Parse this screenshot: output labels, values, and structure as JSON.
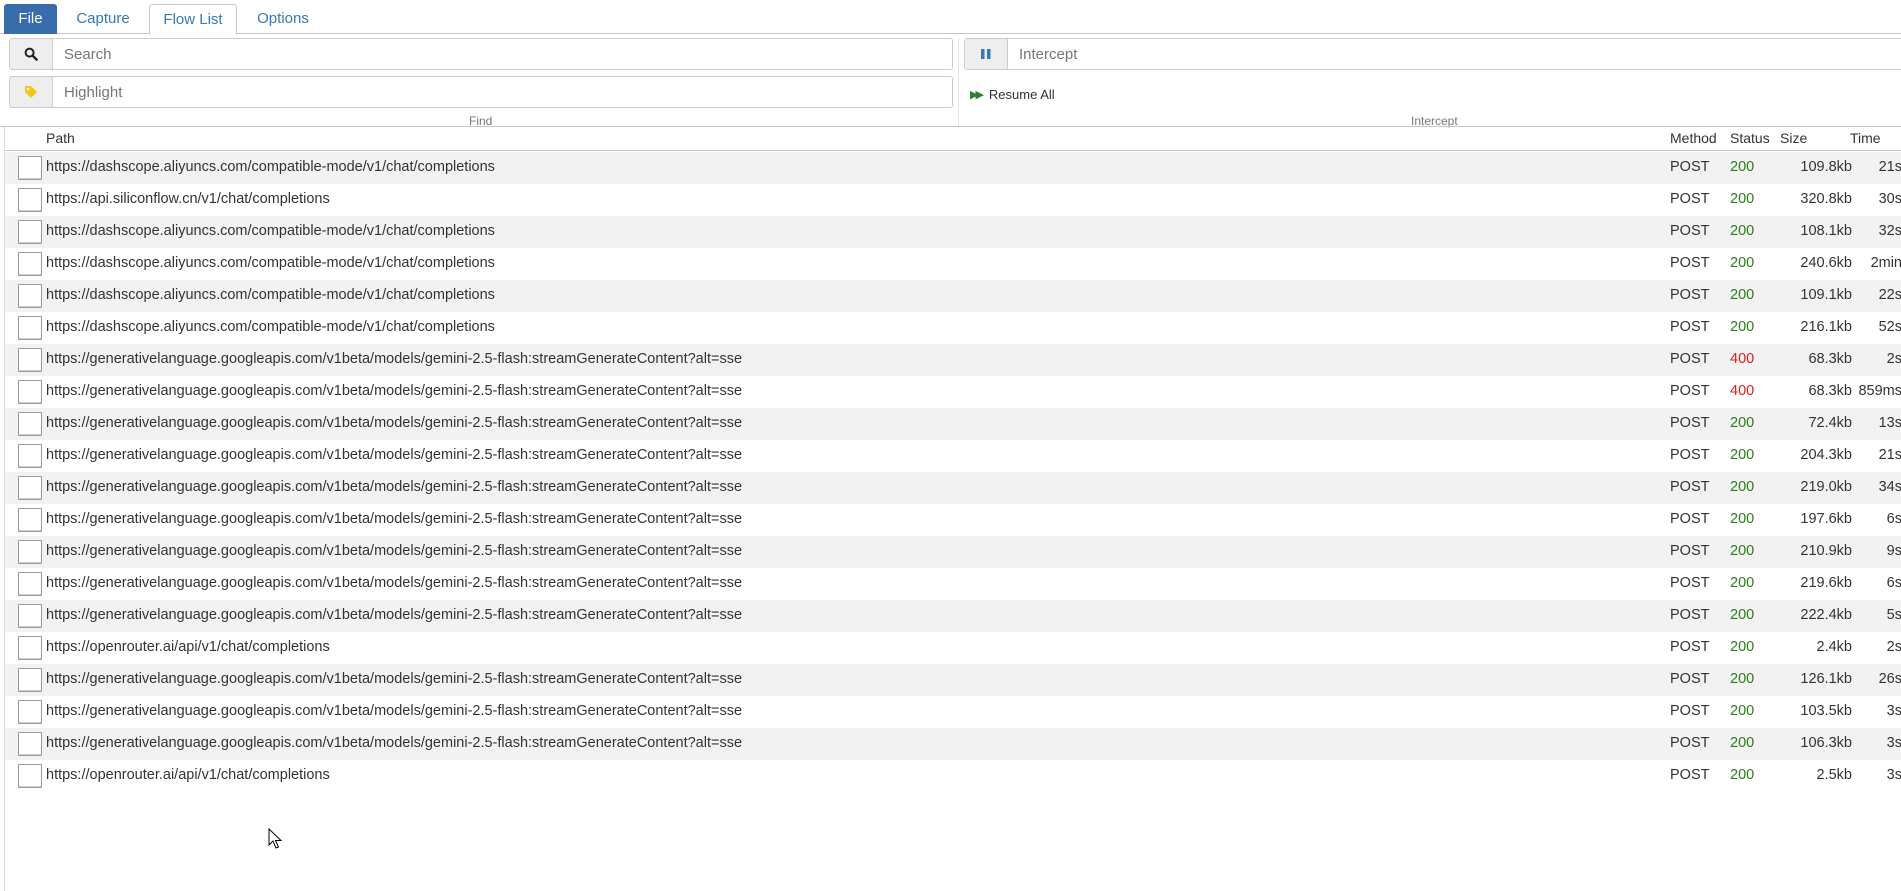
{
  "menu": {
    "tabs": [
      {
        "label": "File"
      },
      {
        "label": "Capture"
      },
      {
        "label": "Flow List"
      },
      {
        "label": "Options"
      }
    ]
  },
  "toolbar": {
    "search_placeholder": "Search",
    "highlight_placeholder": "Highlight",
    "intercept_placeholder": "Intercept",
    "resume_all_label": "Resume All",
    "find_group_label": "Find",
    "intercept_group_label": "Intercept"
  },
  "table": {
    "columns": {
      "path": "Path",
      "method": "Method",
      "status": "Status",
      "size": "Size",
      "time": "Time"
    },
    "rows": [
      {
        "path": "https://dashscope.aliyuncs.com/compatible-mode/v1/chat/completions",
        "method": "POST",
        "status": "200",
        "size": "109.8kb",
        "time": "21s"
      },
      {
        "path": "https://api.siliconflow.cn/v1/chat/completions",
        "method": "POST",
        "status": "200",
        "size": "320.8kb",
        "time": "30s"
      },
      {
        "path": "https://dashscope.aliyuncs.com/compatible-mode/v1/chat/completions",
        "method": "POST",
        "status": "200",
        "size": "108.1kb",
        "time": "32s"
      },
      {
        "path": "https://dashscope.aliyuncs.com/compatible-mode/v1/chat/completions",
        "method": "POST",
        "status": "200",
        "size": "240.6kb",
        "time": "2min"
      },
      {
        "path": "https://dashscope.aliyuncs.com/compatible-mode/v1/chat/completions",
        "method": "POST",
        "status": "200",
        "size": "109.1kb",
        "time": "22s"
      },
      {
        "path": "https://dashscope.aliyuncs.com/compatible-mode/v1/chat/completions",
        "method": "POST",
        "status": "200",
        "size": "216.1kb",
        "time": "52s"
      },
      {
        "path": "https://generativelanguage.googleapis.com/v1beta/models/gemini-2.5-flash:streamGenerateContent?alt=sse",
        "method": "POST",
        "status": "400",
        "size": "68.3kb",
        "time": "2s"
      },
      {
        "path": "https://generativelanguage.googleapis.com/v1beta/models/gemini-2.5-flash:streamGenerateContent?alt=sse",
        "method": "POST",
        "status": "400",
        "size": "68.3kb",
        "time": "859ms"
      },
      {
        "path": "https://generativelanguage.googleapis.com/v1beta/models/gemini-2.5-flash:streamGenerateContent?alt=sse",
        "method": "POST",
        "status": "200",
        "size": "72.4kb",
        "time": "13s"
      },
      {
        "path": "https://generativelanguage.googleapis.com/v1beta/models/gemini-2.5-flash:streamGenerateContent?alt=sse",
        "method": "POST",
        "status": "200",
        "size": "204.3kb",
        "time": "21s"
      },
      {
        "path": "https://generativelanguage.googleapis.com/v1beta/models/gemini-2.5-flash:streamGenerateContent?alt=sse",
        "method": "POST",
        "status": "200",
        "size": "219.0kb",
        "time": "34s"
      },
      {
        "path": "https://generativelanguage.googleapis.com/v1beta/models/gemini-2.5-flash:streamGenerateContent?alt=sse",
        "method": "POST",
        "status": "200",
        "size": "197.6kb",
        "time": "6s"
      },
      {
        "path": "https://generativelanguage.googleapis.com/v1beta/models/gemini-2.5-flash:streamGenerateContent?alt=sse",
        "method": "POST",
        "status": "200",
        "size": "210.9kb",
        "time": "9s"
      },
      {
        "path": "https://generativelanguage.googleapis.com/v1beta/models/gemini-2.5-flash:streamGenerateContent?alt=sse",
        "method": "POST",
        "status": "200",
        "size": "219.6kb",
        "time": "6s"
      },
      {
        "path": "https://generativelanguage.googleapis.com/v1beta/models/gemini-2.5-flash:streamGenerateContent?alt=sse",
        "method": "POST",
        "status": "200",
        "size": "222.4kb",
        "time": "5s"
      },
      {
        "path": "https://openrouter.ai/api/v1/chat/completions",
        "method": "POST",
        "status": "200",
        "size": "2.4kb",
        "time": "2s"
      },
      {
        "path": "https://generativelanguage.googleapis.com/v1beta/models/gemini-2.5-flash:streamGenerateContent?alt=sse",
        "method": "POST",
        "status": "200",
        "size": "126.1kb",
        "time": "26s"
      },
      {
        "path": "https://generativelanguage.googleapis.com/v1beta/models/gemini-2.5-flash:streamGenerateContent?alt=sse",
        "method": "POST",
        "status": "200",
        "size": "103.5kb",
        "time": "3s"
      },
      {
        "path": "https://generativelanguage.googleapis.com/v1beta/models/gemini-2.5-flash:streamGenerateContent?alt=sse",
        "method": "POST",
        "status": "200",
        "size": "106.3kb",
        "time": "3s"
      },
      {
        "path": "https://openrouter.ai/api/v1/chat/completions",
        "method": "POST",
        "status": "200",
        "size": "2.5kb",
        "time": "3s"
      }
    ]
  },
  "colors": {
    "accent": "#396cad",
    "link": "#337ab7",
    "status_ok": "#2e7d1e",
    "status_error": "#d62020",
    "row_alt": "#f2f2f2"
  },
  "icons": [
    "search-icon",
    "tag-icon",
    "pause-icon",
    "fast-forward-icon",
    "request-icon",
    "mouse-cursor-icon"
  ]
}
